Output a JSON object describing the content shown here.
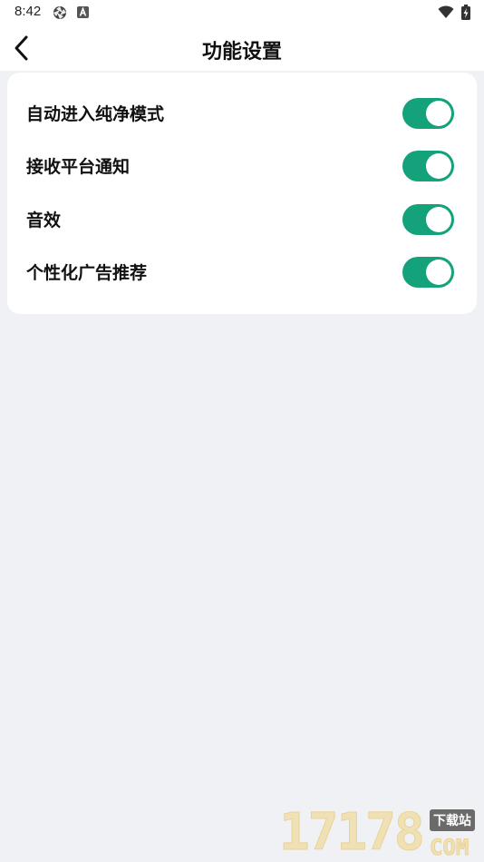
{
  "status_bar": {
    "time": "8:42",
    "icons": [
      "aperture-icon",
      "app-a-icon",
      "wifi-icon",
      "battery-charging-icon"
    ]
  },
  "header": {
    "back_icon": "chevron-left-icon",
    "title": "功能设置"
  },
  "settings": [
    {
      "label": "自动进入纯净模式",
      "enabled": true
    },
    {
      "label": "接收平台通知",
      "enabled": true
    },
    {
      "label": "音效",
      "enabled": true
    },
    {
      "label": "个性化广告推荐",
      "enabled": true
    }
  ],
  "watermark": {
    "digits": "17178",
    "badge": "下载站",
    "suffix": "COM"
  },
  "colors": {
    "toggle_on": "#14a27a",
    "page_background": "#f0f1f5",
    "card_background": "#ffffff"
  }
}
